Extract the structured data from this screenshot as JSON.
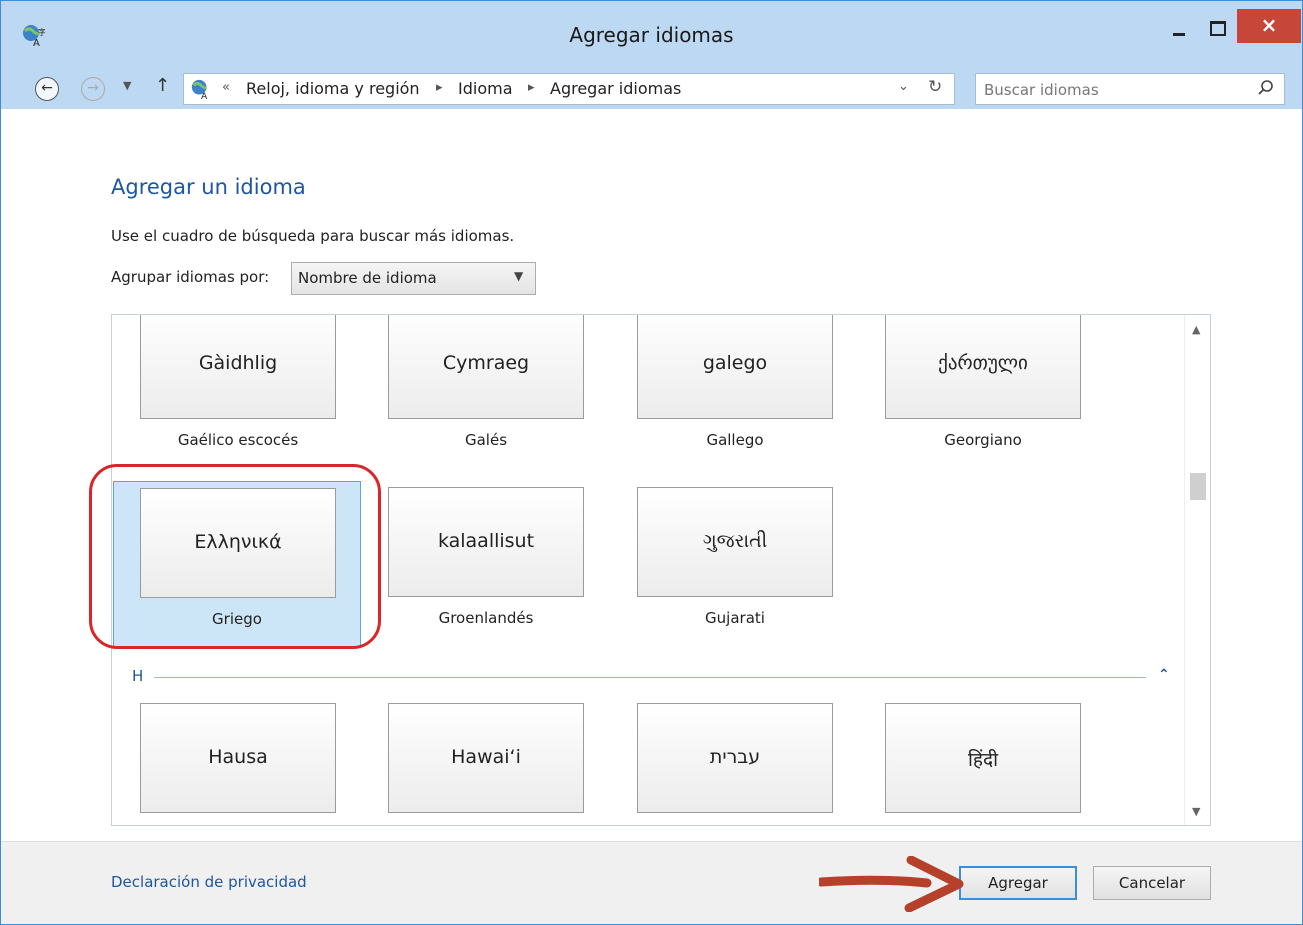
{
  "window": {
    "title": "Agregar idiomas",
    "close_glyph": "×"
  },
  "nav": {
    "breadcrumb_overflow": "«",
    "breadcrumb": [
      "Reloj, idioma y región",
      "Idioma",
      "Agregar idiomas"
    ],
    "search_placeholder": "Buscar idiomas"
  },
  "content": {
    "heading": "Agregar un idioma",
    "hint": "Use el cuadro de búsqueda para buscar más idiomas.",
    "group_by_label": "Agrupar idiomas por:",
    "group_by_value": "Nombre de idioma",
    "languages_g": [
      {
        "native": "Gàidhlig",
        "name": "Gaélico escocés"
      },
      {
        "native": "Cymraeg",
        "name": "Galés"
      },
      {
        "native": "galego",
        "name": "Gallego"
      },
      {
        "native": "ქართული",
        "name": "Georgiano"
      },
      {
        "native": "Ελληνικά",
        "name": "Griego",
        "selected": true
      },
      {
        "native": "kalaallisut",
        "name": "Groenlandés"
      },
      {
        "native": "ગુજરાતી",
        "name": "Gujarati"
      }
    ],
    "group_h_letter": "H",
    "languages_h": [
      {
        "native": "Hausa"
      },
      {
        "native": "Hawaiʻi"
      },
      {
        "native": "עברית"
      },
      {
        "native": "हिंदी"
      }
    ]
  },
  "footer": {
    "privacy_link": "Declaración de privacidad",
    "add_button": "Agregar",
    "cancel_button": "Cancelar"
  },
  "colors": {
    "titlebar": "#bcd8f3",
    "accent_link": "#1d57a0",
    "selection": "#cde6f7",
    "annotation_red": "#d9262a",
    "annotation_arrow": "#b5412b",
    "close_button": "#c7463a"
  }
}
